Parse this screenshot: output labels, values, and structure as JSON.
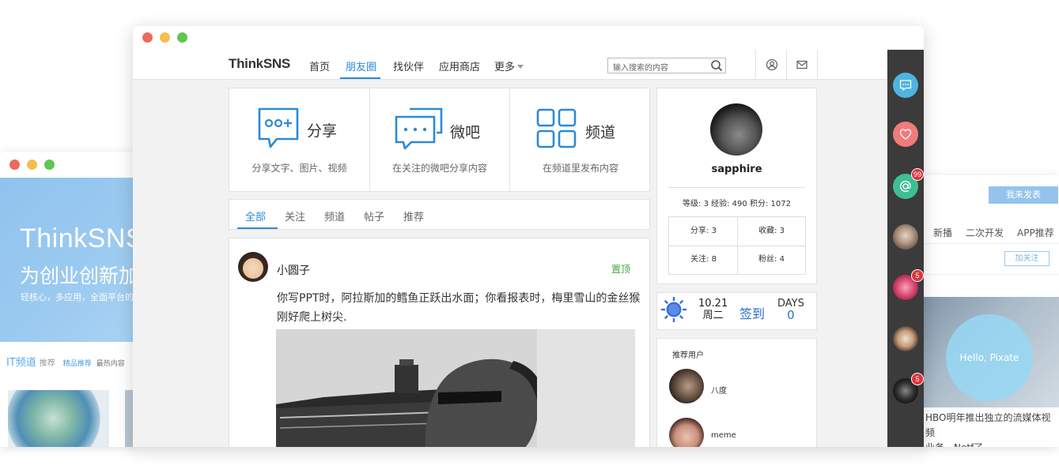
{
  "back_left": {
    "title": "ThinkSNS",
    "slogan": "为创业创新加",
    "tagline": "轻核心，多应用，全面平台的",
    "channel": "IT频道",
    "channel_rec": "推荐",
    "tab_selected": "精品推荐",
    "tab_hot": "最热内容"
  },
  "back_right": {
    "post_button": "我来发表",
    "tabs": [
      "新播",
      "二次开发",
      "APP推荐"
    ],
    "follow_button": "加关注",
    "photo_caption": "Hello, Pixate",
    "news_line1": "HBO明年推出独立的流媒体视频",
    "news_line2": "业务，Netf了..."
  },
  "nav": {
    "logo": "ThinkSNS",
    "items": [
      "首页",
      "朋友圈",
      "找伙伴",
      "应用商店",
      "更多"
    ],
    "active": "朋友圈",
    "search_placeholder": "输入搜索的内容",
    "icons": [
      "user-icon",
      "mail-icon"
    ]
  },
  "quick": [
    {
      "title": "分享",
      "desc": "分享文字、图片、视频",
      "icon": "share-bubble-icon"
    },
    {
      "title": "微吧",
      "desc": "在关注的微吧分享内容",
      "icon": "weiba-bubble-icon"
    },
    {
      "title": "频道",
      "desc": "在频道里发布内容",
      "icon": "channel-grid-icon"
    }
  ],
  "feed_tabs": [
    "全部",
    "关注",
    "频道",
    "帖子",
    "推荐"
  ],
  "post": {
    "username": "小圆子",
    "pin": "置顶",
    "text": "你写PPT时，阿拉斯加的鳕鱼正跃出水面；你看报表时，梅里雪山的金丝猴刚好爬上树尖."
  },
  "profile": {
    "name": "sapphire",
    "level_line": "等级: 3  经验: 490  积分: 1072",
    "share": "分享: 3",
    "favorites": "收藏: 3",
    "following": "关注: 8",
    "fans": "粉丝: 4"
  },
  "checkin": {
    "date": "10.21",
    "weekday": "周二",
    "sign": "签到",
    "days_label": "DAYS",
    "days": "0"
  },
  "recommend": {
    "header": "推荐用户",
    "users": [
      "八度",
      "meme"
    ]
  },
  "sidebar": {
    "items": [
      {
        "icon": "chat-icon",
        "color": "#4db4e0",
        "badge": ""
      },
      {
        "icon": "heart-icon",
        "color": "#f07b7b",
        "badge": ""
      },
      {
        "icon": "at-icon",
        "color": "#3dbf93",
        "badge": "99"
      },
      {
        "icon": "avatar",
        "color": "#9b8a7a",
        "badge": ""
      },
      {
        "icon": "avatar",
        "color": "#d94470",
        "badge": "5"
      },
      {
        "icon": "avatar",
        "color": "#c59a7a",
        "badge": ""
      },
      {
        "icon": "avatar",
        "color": "#222222",
        "badge": "5"
      }
    ]
  },
  "colors": {
    "accent": "#2b8ad8",
    "pin_green": "#3da73d",
    "sidebar_bg": "#3b3b3b"
  }
}
